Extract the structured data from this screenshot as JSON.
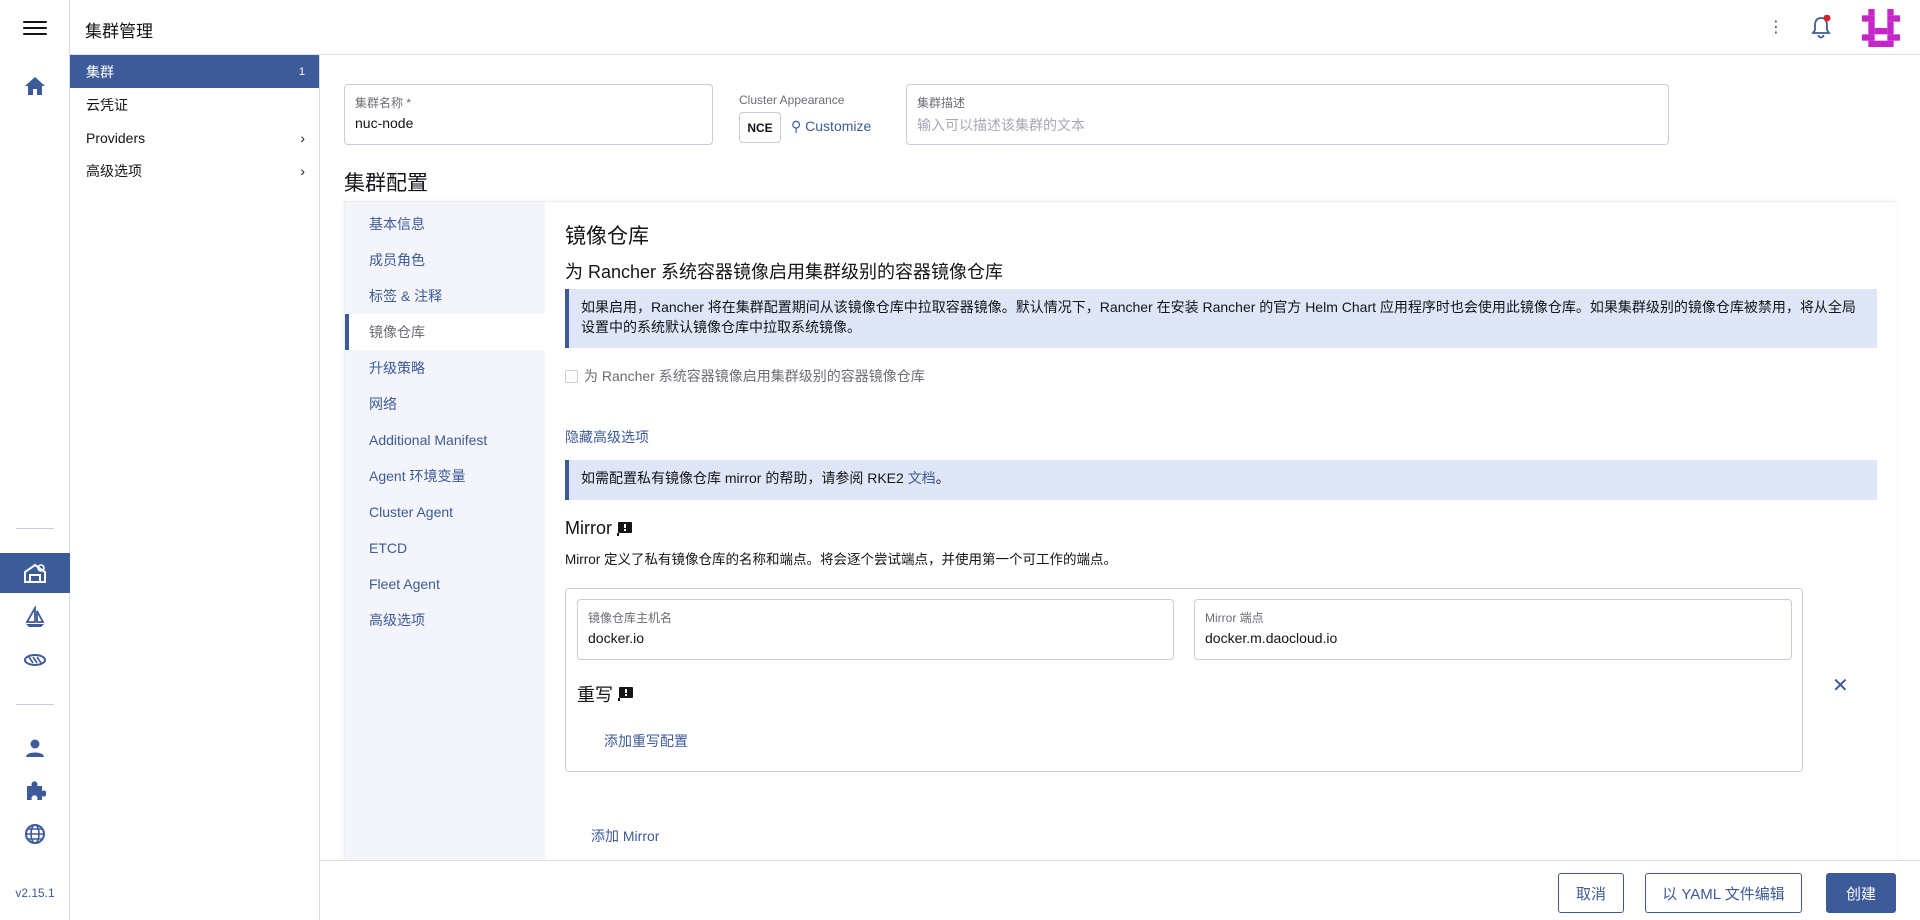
{
  "app": {
    "version": "v2.15.1"
  },
  "header": {
    "title": "集群管理"
  },
  "sidenav": {
    "items": [
      {
        "label": "集群",
        "count": "1"
      },
      {
        "label": "云凭证"
      },
      {
        "label": "Providers"
      },
      {
        "label": "高级选项"
      }
    ]
  },
  "form": {
    "cluster_name_label": "集群名称 *",
    "cluster_name_value": "nuc-node",
    "appearance_label": "Cluster Appearance",
    "appearance_badge": "NCE",
    "customize_label": "Customize",
    "description_label": "集群描述",
    "description_placeholder": "输入可以描述该集群的文本"
  },
  "config": {
    "title": "集群配置",
    "tabs": [
      "基本信息",
      "成员角色",
      "标签 & 注释",
      "镜像仓库",
      "升级策略",
      "网络",
      "Additional Manifest",
      "Agent 环境变量",
      "Cluster Agent",
      "ETCD",
      "Fleet Agent",
      "高级选项"
    ],
    "active_tab": "镜像仓库"
  },
  "registry": {
    "title": "镜像仓库",
    "subtitle": "为 Rancher 系统容器镜像启用集群级别的容器镜像仓库",
    "banner": "如果启用，Rancher 将在集群配置期间从该镜像仓库中拉取容器镜像。默认情况下，Rancher 在安装 Rancher 的官方 Helm Chart 应用程序时也会使用此镜像仓库。如果集群级别的镜像仓库被禁用，将从全局设置中的系统默认镜像仓库中拉取系统镜像。",
    "checkbox_label": "为 Rancher 系统容器镜像启用集群级别的容器镜像仓库",
    "hide_advanced": "隐藏高级选项",
    "help_prefix": "如需配置私有镜像仓库 mirror 的帮助，请参阅 RKE2 ",
    "help_link": "文档",
    "help_suffix": "。",
    "mirror_title": "Mirror",
    "mirror_desc": "Mirror 定义了私有镜像仓库的名称和端点。将会逐个尝试端点，并使用第一个可工作的端点。",
    "host_label": "镜像仓库主机名",
    "host_value": "docker.io",
    "endpoint_label": "Mirror 端点",
    "endpoint_value": "docker.m.daocloud.io",
    "rewrite_title": "重写",
    "add_rewrite": "添加重写配置",
    "add_mirror": "添加 Mirror",
    "remove": "✕"
  },
  "footer": {
    "cancel": "取消",
    "edit_yaml": "以 YAML 文件编辑",
    "create": "创建"
  },
  "colors": {
    "accent": "#3d5a99",
    "banner_bg": "#dfe6f7",
    "notification_dot": "#d6232b",
    "avatar": "#c526c9"
  },
  "icons": {
    "rail": [
      "menu-icon",
      "home-icon",
      "cluster-icon",
      "fleet-sail-icon",
      "extensions-icon",
      "user-icon",
      "puzzle-icon",
      "globe-icon"
    ],
    "header": [
      "kebab-icon",
      "bell-icon",
      "avatar-icon"
    ]
  }
}
